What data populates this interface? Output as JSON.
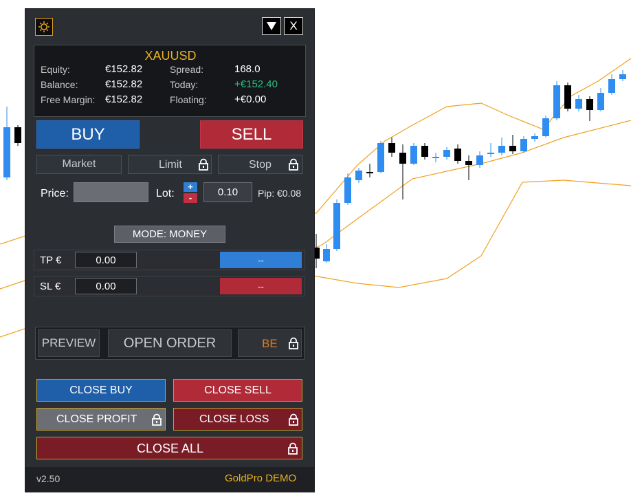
{
  "panel": {
    "symbol": "XAUUSD",
    "equity_label": "Equity:",
    "equity_value": "€152.82",
    "balance_label": "Balance:",
    "balance_value": "€152.82",
    "free_margin_label": "Free Margin:",
    "free_margin_value": "€152.82",
    "spread_label": "Spread:",
    "spread_value": "168.0",
    "today_label": "Today:",
    "today_value": "+€152.40",
    "floating_label": "Floating:",
    "floating_value": "+€0.00",
    "buy_label": "BUY",
    "sell_label": "SELL",
    "tabs": [
      "Market",
      "Limit",
      "Stop"
    ],
    "price_label": "Price:",
    "price_value": "",
    "lot_label": "Lot:",
    "lot_value": "0.10",
    "plus_label": "+",
    "minus_label": "-",
    "pip_label": "Pip: €0.08",
    "mode_label": "MODE: MONEY",
    "tp_label": "TP €",
    "tp_value": "0.00",
    "tp_button": "--",
    "sl_label": "SL €",
    "sl_value": "0.00",
    "sl_button": "--",
    "preview_label": "PREVIEW",
    "open_order_label": "OPEN ORDER",
    "be_label": "BE",
    "close_buy_label": "CLOSE BUY",
    "close_sell_label": "CLOSE SELL",
    "close_profit_label": "CLOSE PROFIT",
    "close_loss_label": "CLOSE LOSS",
    "close_all_label": "CLOSE ALL",
    "version": "v2.50",
    "product": "GoldPro DEMO",
    "minimize_icon": "triangle-down",
    "close_icon": "X",
    "settings_icon": "gear"
  },
  "colors": {
    "bull": "#2f8cf0",
    "bear": "#000000",
    "band": "#f0a020",
    "buy": "#1f5ea8",
    "sell": "#b02a38",
    "gold_text": "#e8b020",
    "green_text": "#2fbf80",
    "be_text": "#e07a20"
  }
}
